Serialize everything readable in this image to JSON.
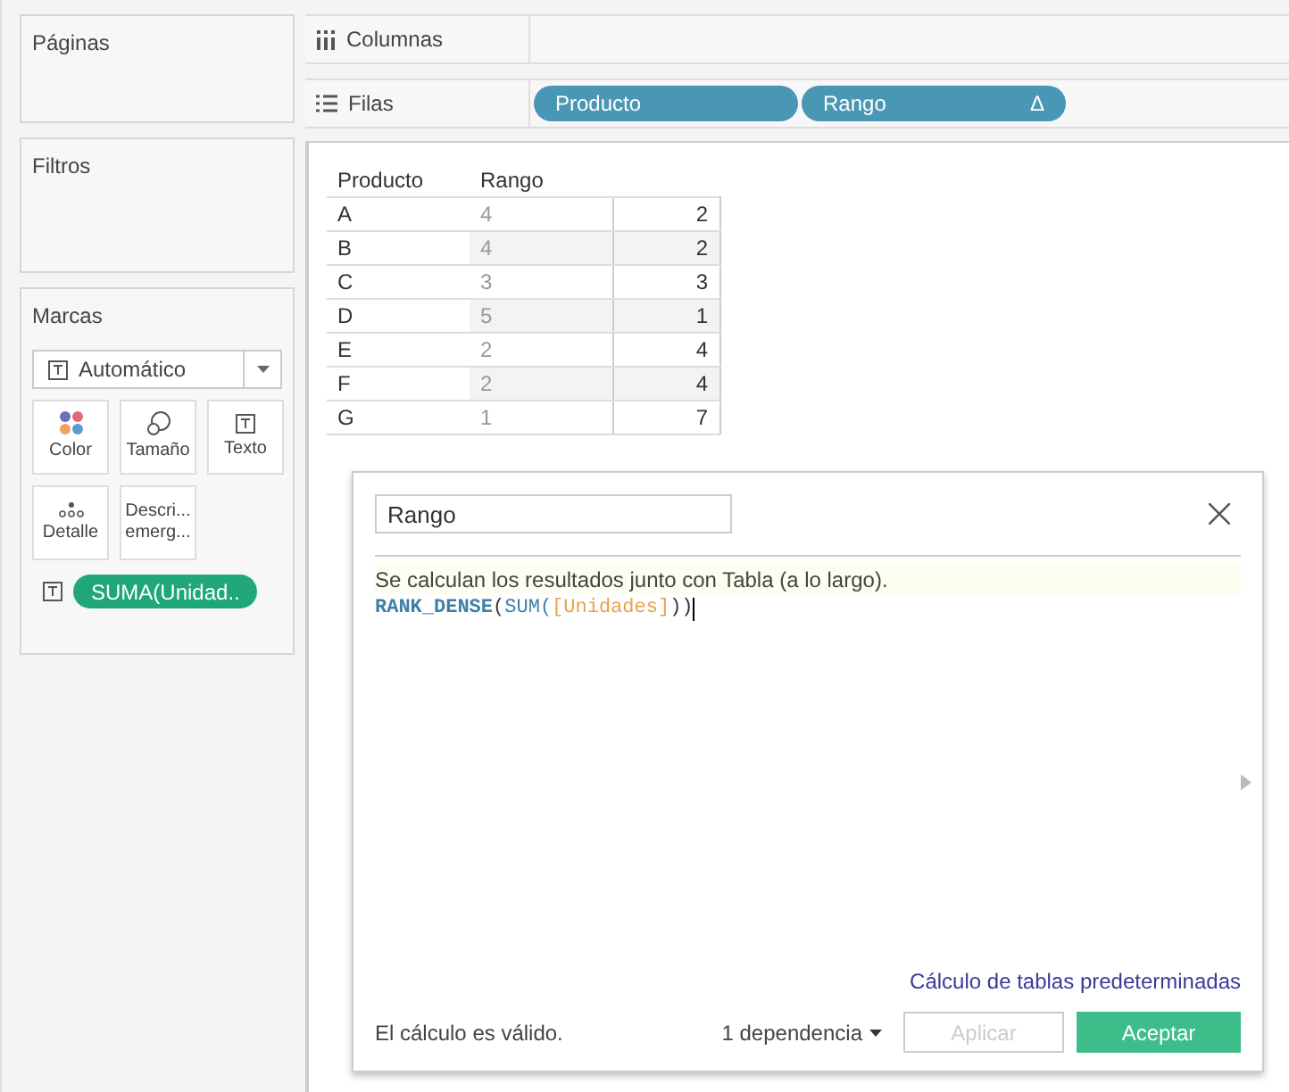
{
  "panels": {
    "pages": {
      "title": "Páginas"
    },
    "filters": {
      "title": "Filtros"
    },
    "marks": {
      "title": "Marcas",
      "mark_type": "Automático",
      "buttons": [
        {
          "label": "Color",
          "kind": "color"
        },
        {
          "label": "Tamaño",
          "kind": "size"
        },
        {
          "label": "Texto",
          "kind": "text"
        },
        {
          "label": "Detalle",
          "kind": "detail"
        },
        {
          "label": "Descri... emerg...",
          "kind": "tooltip"
        }
      ],
      "field": {
        "label": "SUMA(Unidad..",
        "kind": "text"
      }
    }
  },
  "shelves": {
    "columns": {
      "label": "Columnas"
    },
    "rows": {
      "label": "Filas",
      "pills": [
        {
          "label": "Producto"
        },
        {
          "label": "Rango",
          "delta": "Δ"
        }
      ]
    }
  },
  "table": {
    "columns": [
      "Producto",
      "Rango"
    ],
    "rows": [
      {
        "producto": "A",
        "rango": "4",
        "column_3": "2"
      },
      {
        "producto": "B",
        "rango": "4",
        "column_3": "2"
      },
      {
        "producto": "C",
        "rango": "3",
        "column_3": "3"
      },
      {
        "producto": "D",
        "rango": "5",
        "column_3": "1"
      },
      {
        "producto": "E",
        "rango": "2",
        "column_3": "4"
      },
      {
        "producto": "F",
        "rango": "2",
        "column_3": "4"
      },
      {
        "producto": "G",
        "rango": "1",
        "column_3": "7"
      }
    ]
  },
  "dialog": {
    "name": "Rango",
    "note": "Se calculan los resultados junto con Tabla (a lo largo).",
    "formula": [
      {
        "text": "RANK_DENSE",
        "kind": "function_bold"
      },
      {
        "text": "(",
        "kind": "paren"
      },
      {
        "text": "SUM",
        "kind": "function"
      },
      {
        "text": "(",
        "kind": "function"
      },
      {
        "text": "[Unidades]",
        "kind": "field"
      },
      {
        "text": "))",
        "kind": "paren"
      }
    ],
    "link": "Cálculo de tablas predeterminadas",
    "status": "El cálculo es válido.",
    "dependency": "1 dependencia",
    "buttons": [
      {
        "label": "Aplicar",
        "kind": "secondary",
        "disabled": true
      },
      {
        "label": "Aceptar",
        "kind": "primary",
        "disabled": false
      }
    ]
  }
}
